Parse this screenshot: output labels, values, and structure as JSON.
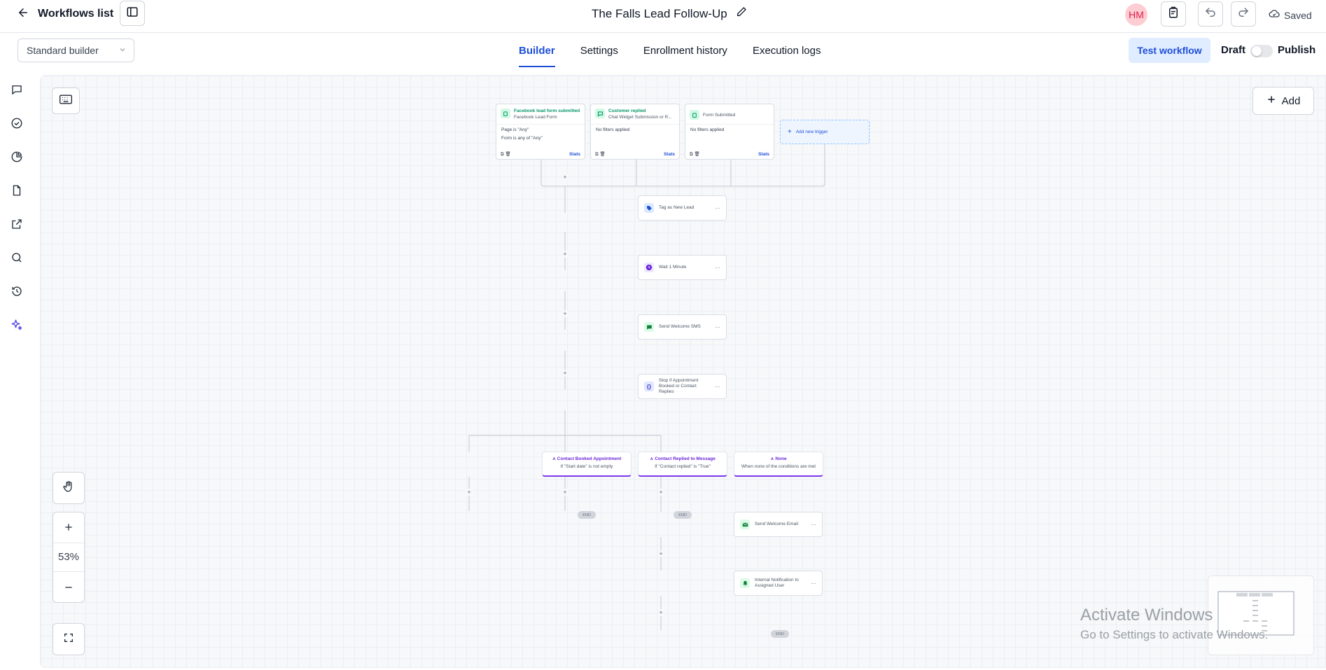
{
  "header": {
    "back_label": "Workflows list",
    "workflow_title": "The Falls Lead Follow-Up",
    "avatar_initials": "HM",
    "saved_label": "Saved"
  },
  "subbar": {
    "builder_mode": "Standard builder",
    "tabs": [
      {
        "label": "Builder",
        "active": true
      },
      {
        "label": "Settings",
        "active": false
      },
      {
        "label": "Enrollment history",
        "active": false
      },
      {
        "label": "Execution logs",
        "active": false
      }
    ],
    "test_workflow_label": "Test workflow",
    "draft_label": "Draft",
    "publish_label": "Publish",
    "published": false
  },
  "rail": {
    "icons": [
      "chat-icon",
      "check-circle-icon",
      "pie-chart-icon",
      "document-icon",
      "external-link-icon",
      "search-icon",
      "history-icon",
      "sparkles-icon"
    ]
  },
  "canvas": {
    "add_label": "Add",
    "zoom_level": "53%",
    "triggers": [
      {
        "title": "Facebook lead form submitted",
        "subtitle": "Facebook Lead Form",
        "filters": [
          "Page is \"Any\"",
          "Form is any of \"Any\""
        ],
        "stats_label": "Stats"
      },
      {
        "title": "Customer replied",
        "subtitle": "Chat Widget Submission or R...",
        "filters": [
          "No filters applied"
        ],
        "stats_label": "Stats"
      },
      {
        "title": "",
        "subtitle": "Form Submitted",
        "filters": [
          "No filters applied"
        ],
        "stats_label": "Stats"
      }
    ],
    "add_trigger_label": "Add new trigger",
    "actions": {
      "tag": "Tag as New Lead",
      "wait": "Wait 1 Minute",
      "sms": "Send Welcome SMS",
      "ifelse": "Stop if Appointment Booked or Contact Replies",
      "email": "Send Welcome Email",
      "notify": "Internal Notification to Assigned User"
    },
    "branches": [
      {
        "title": "Contact Booked Appointment",
        "condition": "If \"Start date\" is not empty"
      },
      {
        "title": "Contact Replied to Message",
        "condition": "If \"Contact replied\" is \"True\""
      },
      {
        "title": "None",
        "condition": "When none of the conditions are met"
      }
    ],
    "end_label": "END",
    "colors": {
      "accent": "#1d4ed8",
      "trigger_green": "#059669",
      "branch_purple": "#7c3aed"
    }
  },
  "watermark": {
    "line1": "Activate Windows",
    "line2": "Go to Settings to activate Windows."
  }
}
